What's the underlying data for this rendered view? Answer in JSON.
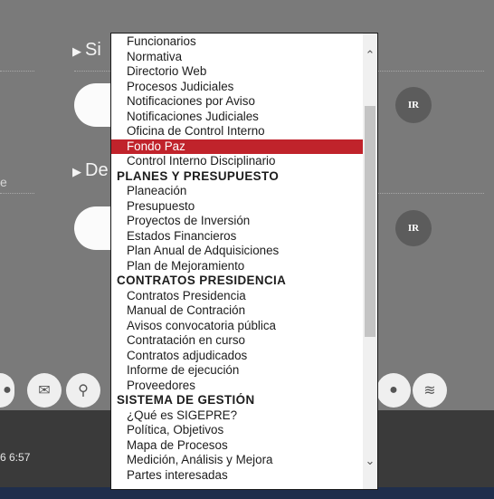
{
  "background": {
    "section1_label": "Si",
    "section2_label": "De",
    "left_text": "e",
    "ir_button_1": "IR",
    "ir_button_2": "IR",
    "footer_time": "6 6:57"
  },
  "social_icons": [
    "profile-icon",
    "mail-icon",
    "search-icon",
    "social-icon",
    "rss-icon"
  ],
  "dropdown": {
    "selected_value": "Fondo Paz",
    "options": [
      {
        "label": "Funcionarios",
        "group": false
      },
      {
        "label": "Normativa",
        "group": false
      },
      {
        "label": "Directorio Web",
        "group": false
      },
      {
        "label": "Procesos Judiciales",
        "group": false
      },
      {
        "label": "Notificaciones por Aviso",
        "group": false
      },
      {
        "label": "Notificaciones Judiciales",
        "group": false
      },
      {
        "label": "Oficina de Control Interno",
        "group": false
      },
      {
        "label": "Fondo Paz",
        "group": false,
        "selected": true
      },
      {
        "label": "Control Interno Disciplinario",
        "group": false
      },
      {
        "label": "PLANES Y PRESUPUESTO",
        "group": true
      },
      {
        "label": "Planeación",
        "group": false
      },
      {
        "label": "Presupuesto",
        "group": false
      },
      {
        "label": "Proyectos de Inversión",
        "group": false
      },
      {
        "label": "Estados Financieros",
        "group": false
      },
      {
        "label": "Plan Anual de Adquisiciones",
        "group": false
      },
      {
        "label": "Plan de Mejoramiento",
        "group": false
      },
      {
        "label": "CONTRATOS PRESIDENCIA",
        "group": true
      },
      {
        "label": "Contratos Presidencia",
        "group": false
      },
      {
        "label": "Manual de Contración",
        "group": false
      },
      {
        "label": "Avisos convocatoria pública",
        "group": false
      },
      {
        "label": "Contratación en curso",
        "group": false
      },
      {
        "label": "Contratos adjudicados",
        "group": false
      },
      {
        "label": "Informe de ejecución",
        "group": false
      },
      {
        "label": "Proveedores",
        "group": false
      },
      {
        "label": "SISTEMA DE GESTIÓN",
        "group": true
      },
      {
        "label": "¿Qué es SIGEPRE?",
        "group": false
      },
      {
        "label": "Política, Objetivos",
        "group": false
      },
      {
        "label": "Mapa de Procesos",
        "group": false
      },
      {
        "label": "Medición, Análisis y Mejora",
        "group": false
      },
      {
        "label": "Partes interesadas",
        "group": false
      }
    ],
    "selected_color": "#c0232b"
  }
}
